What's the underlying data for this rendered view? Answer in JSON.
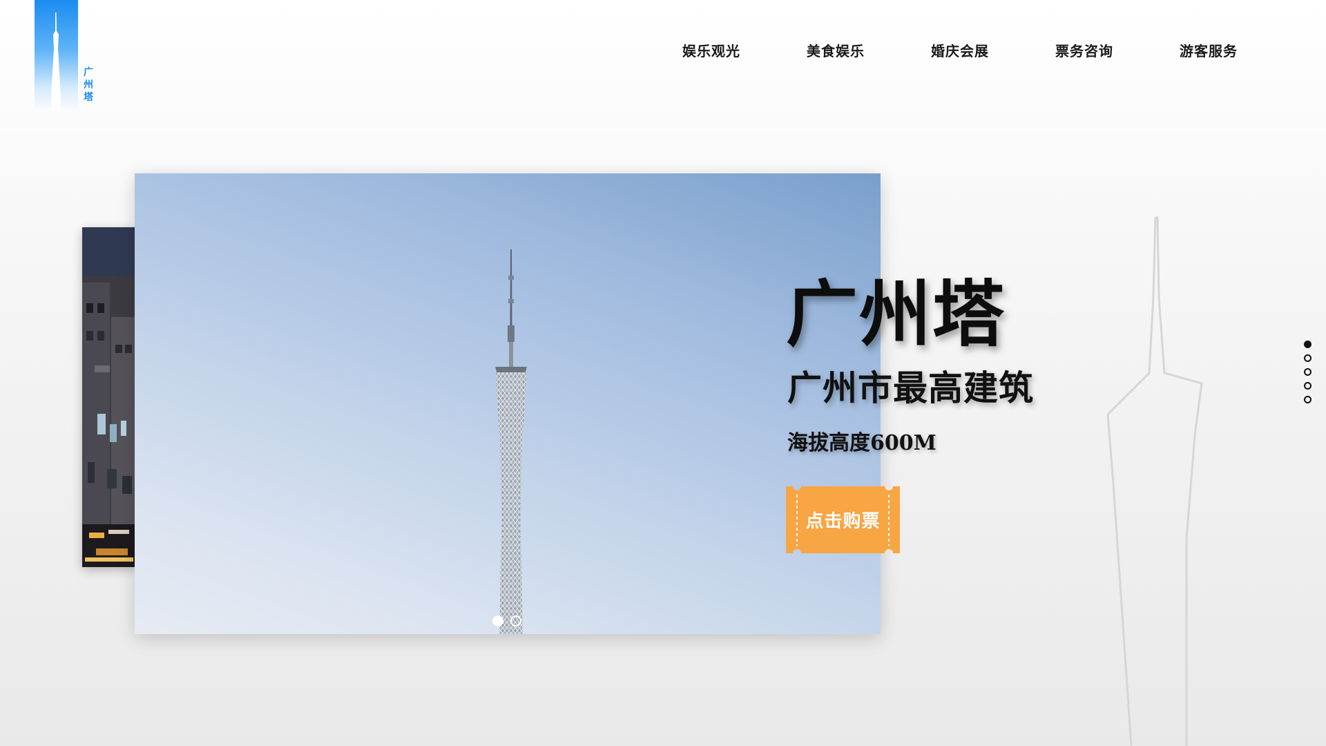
{
  "logo": {
    "text_chars": [
      "广",
      "州",
      "塔"
    ],
    "color": "#1a8cf0"
  },
  "nav": {
    "items": [
      {
        "label": "娱乐观光"
      },
      {
        "label": "美食娱乐"
      },
      {
        "label": "婚庆会展"
      },
      {
        "label": "票务咨询"
      },
      {
        "label": "游客服务"
      }
    ]
  },
  "hero": {
    "title": "广州塔",
    "subtitle": "广州市最高建筑",
    "altitude": "海拔高度600M",
    "cta_label": "点击购票",
    "cta_color": "#f8a543"
  },
  "carousel": {
    "slide_count": 2,
    "active_index": 0
  },
  "page_nav": {
    "count": 5,
    "active_index": 0
  }
}
